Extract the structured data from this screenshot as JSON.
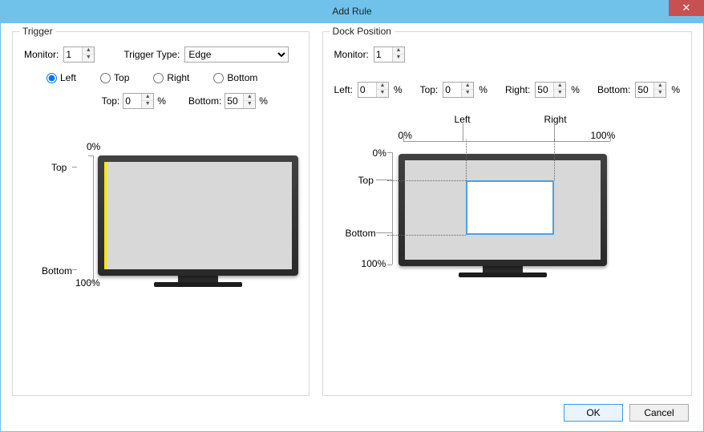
{
  "window": {
    "title": "Add Rule"
  },
  "trigger": {
    "group_label": "Trigger",
    "monitor_label": "Monitor:",
    "monitor_value": "1",
    "type_label": "Trigger Type:",
    "type_options": [
      "Edge"
    ],
    "type_selected": "Edge",
    "radio_left": "Left",
    "radio_top": "Top",
    "radio_right": "Right",
    "radio_bottom": "Bottom",
    "radio_selected": "Left",
    "top_label": "Top:",
    "top_value": "0",
    "bottom_label": "Bottom:",
    "bottom_value": "50",
    "diagram": {
      "zero_pct": "0%",
      "hundred_pct": "100%",
      "top_lbl": "Top",
      "bottom_lbl": "Bottom"
    }
  },
  "dock": {
    "group_label": "Dock Position",
    "monitor_label": "Monitor:",
    "monitor_value": "1",
    "left_label": "Left:",
    "left_value": "0",
    "top_label": "Top:",
    "top_value": "0",
    "right_label": "Right:",
    "right_value": "50",
    "bottom_label": "Bottom:",
    "bottom_value": "50",
    "diagram": {
      "zero_pct": "0%",
      "hundred_pct": "100%",
      "left_lbl": "Left",
      "right_lbl": "Right",
      "top_lbl": "Top",
      "bottom_lbl": "Bottom"
    }
  },
  "buttons": {
    "ok": "OK",
    "cancel": "Cancel"
  },
  "pct_sign": "%"
}
